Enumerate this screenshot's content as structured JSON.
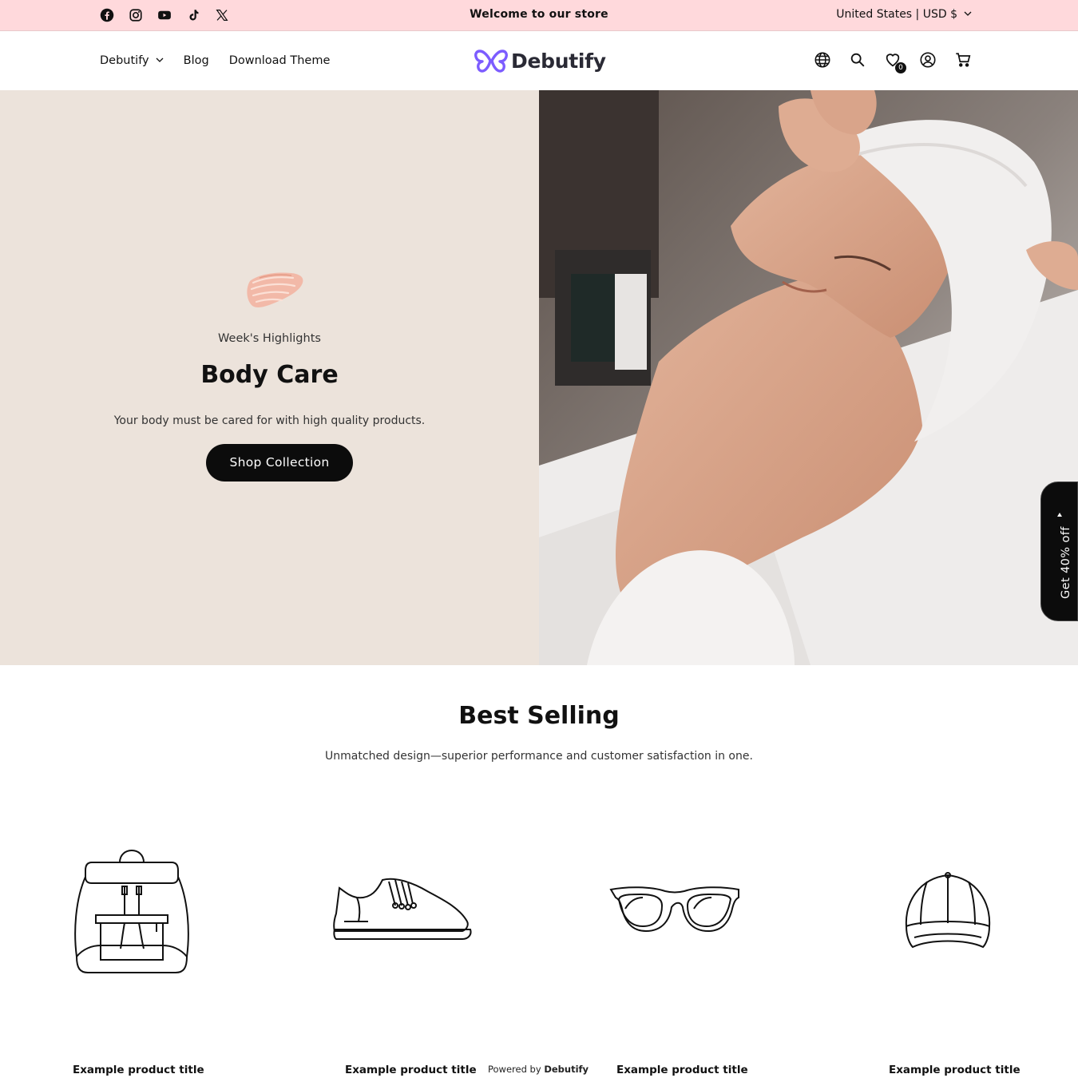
{
  "announcement": {
    "text": "Welcome to our store",
    "socials": [
      "facebook-icon",
      "instagram-icon",
      "youtube-icon",
      "tiktok-icon",
      "x-icon"
    ],
    "locale": "United States | USD $"
  },
  "header": {
    "nav": [
      {
        "label": "Debutify",
        "has_dropdown": true
      },
      {
        "label": "Blog",
        "has_dropdown": false
      },
      {
        "label": "Download Theme",
        "has_dropdown": false
      }
    ],
    "logo_text": "Debutify",
    "logo_color": "#7c5cff",
    "icons": [
      "globe-icon",
      "search-icon",
      "wishlist-icon",
      "account-icon",
      "cart-icon"
    ],
    "wishlist_count": "0"
  },
  "hero": {
    "subheading": "Week's Highlights",
    "title": "Body Care",
    "description": "Your body must be cared for with high quality products.",
    "button_label": "Shop Collection",
    "background": "#ece3db"
  },
  "promo_tab": {
    "label": "Get 40% off"
  },
  "best_selling": {
    "title": "Best Selling",
    "subtitle": "Unmatched design—superior performance and customer satisfaction in one.",
    "products": [
      {
        "title": "Example product title",
        "icon": "backpack-icon"
      },
      {
        "title": "Example product title",
        "icon": "sneaker-icon"
      },
      {
        "title": "Example product title",
        "icon": "sunglasses-icon"
      },
      {
        "title": "Example product title",
        "icon": "cap-icon"
      }
    ]
  },
  "footer_badge": {
    "prefix": "Powered by",
    "brand": "Debutify"
  }
}
